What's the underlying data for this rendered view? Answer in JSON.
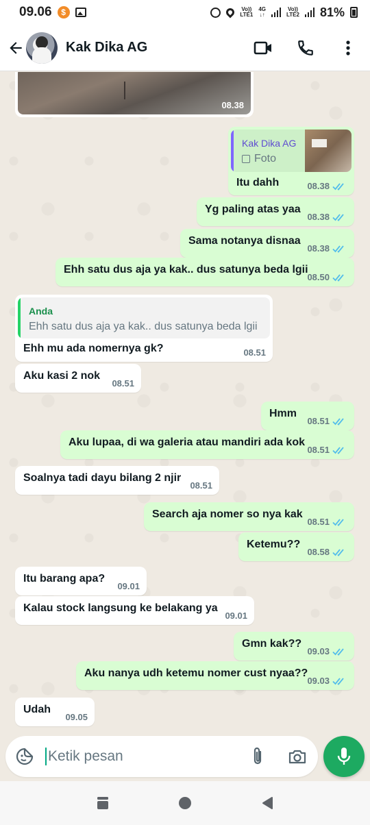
{
  "status_bar": {
    "time": "09.06",
    "sim1_label_top": "Vo))",
    "sim1_label_bottom": "LTE1",
    "net_label_top": "4G",
    "sim2_label_top": "Vo))",
    "sim2_label_bottom": "LTE2",
    "battery": "81%"
  },
  "header": {
    "contact_name": "Kak Dika AG"
  },
  "messages": [
    {
      "id": "m0",
      "type": "image",
      "dir": "in",
      "time": "08.38"
    },
    {
      "id": "m1",
      "dir": "out",
      "quote_author": "Kak Dika AG",
      "quote_text": "Foto",
      "text": "Itu dahh",
      "time": "08.38"
    },
    {
      "id": "m2",
      "dir": "out",
      "text": "Yg paling atas yaa",
      "time": "08.38"
    },
    {
      "id": "m3",
      "dir": "out",
      "text": "Sama notanya disnaa",
      "time": "08.38"
    },
    {
      "id": "m4",
      "dir": "out",
      "text": "Ehh satu dus aja ya kak.. dus satunya beda lgii",
      "time": "08.50"
    },
    {
      "id": "m5",
      "dir": "in",
      "quote_author": "Anda",
      "quote_text": "Ehh satu dus aja ya kak.. dus satunya beda lgii",
      "text": "Ehh mu ada nomernya gk?",
      "time": "08.51"
    },
    {
      "id": "m6",
      "dir": "in",
      "text": "Aku kasi 2 nok",
      "time": "08.51"
    },
    {
      "id": "m7",
      "dir": "out",
      "text": "Hmm",
      "time": "08.51"
    },
    {
      "id": "m8",
      "dir": "out",
      "text": "Aku lupaa, di wa galeria atau mandiri ada kok",
      "time": "08.51"
    },
    {
      "id": "m9",
      "dir": "in",
      "text": "Soalnya tadi dayu bilang 2 njir",
      "time": "08.51"
    },
    {
      "id": "m10",
      "dir": "out",
      "text": "Search aja nomer so nya kak",
      "time": "08.51"
    },
    {
      "id": "m11",
      "dir": "out",
      "text": "Ketemu??",
      "time": "08.58"
    },
    {
      "id": "m12",
      "dir": "in",
      "text": "Itu barang apa?",
      "time": "09.01"
    },
    {
      "id": "m13",
      "dir": "in",
      "text": "Kalau stock langsung ke belakang ya",
      "time": "09.01"
    },
    {
      "id": "m14",
      "dir": "out",
      "text": "Gmn kak??",
      "time": "09.03"
    },
    {
      "id": "m15",
      "dir": "out",
      "text": "Aku nanya udh ketemu nomer cust nyaa??",
      "time": "09.03"
    },
    {
      "id": "m16",
      "dir": "in",
      "text": "Udah",
      "time": "09.05"
    }
  ],
  "composer": {
    "placeholder": "Ketik pesan"
  },
  "colors": {
    "outgoing_bubble": "#d9fdd3",
    "incoming_bubble": "#ffffff",
    "read_ticks": "#53bdeb",
    "accent_green": "#1daa61",
    "quote_self_bar": "#7f66ff",
    "quote_other_bar": "#25d366"
  },
  "icons": [
    "back-arrow-icon",
    "video-call-icon",
    "voice-call-icon",
    "more-options-icon",
    "sticker-icon",
    "attach-icon",
    "camera-icon",
    "mic-icon",
    "photo-icon"
  ]
}
